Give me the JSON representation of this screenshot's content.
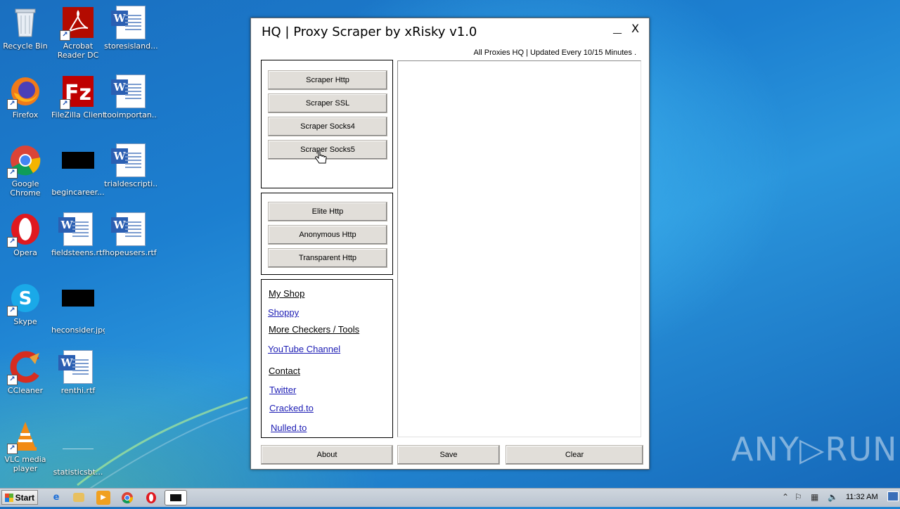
{
  "desktop": {
    "icons": [
      {
        "label": "Recycle Bin"
      },
      {
        "label": "Acrobat\nReader DC"
      },
      {
        "label": "storesisland..."
      },
      {
        "label": "Firefox"
      },
      {
        "label": "FileZilla Client"
      },
      {
        "label": "tooimportan..."
      },
      {
        "label": "Google\nChrome"
      },
      {
        "label": "begincareer..."
      },
      {
        "label": "trialdescripti..."
      },
      {
        "label": "Opera"
      },
      {
        "label": "fieldsteens.rtf"
      },
      {
        "label": "hopeusers.rtf"
      },
      {
        "label": "Skype"
      },
      {
        "label": "heconsider.jpg"
      },
      {
        "label": "CCleaner"
      },
      {
        "label": "renthi.rtf"
      },
      {
        "label": "VLC media\nplayer"
      },
      {
        "label": "statisticsbt..."
      }
    ]
  },
  "app": {
    "title": "HQ | Proxy Scraper by xRisky v1.0",
    "minimize": "__",
    "close": "X",
    "subtitle": "All Proxies HQ | Updated Every 10/15 Minutes .",
    "scraper_buttons": [
      "Scraper Http",
      "Scraper SSL",
      "Scraper Socks4",
      "Scraper Socks5"
    ],
    "filter_buttons": [
      "Elite Http",
      "Anonymous Http",
      "Transparent Http"
    ],
    "links": {
      "my_shop": "My Shop",
      "shoppy": "Shoppy",
      "more_checkers": "More Checkers / Tools",
      "youtube": "YouTube Channel",
      "contact": "Contact",
      "twitter": "Twitter",
      "cracked": "Cracked.to",
      "nulled": "Nulled.to"
    },
    "bottom_buttons": {
      "about": "About",
      "save": "Save",
      "clear": "Clear"
    }
  },
  "watermark": "ANY▷RUN",
  "taskbar": {
    "start_label": "Start",
    "clock": "11:32 AM"
  }
}
